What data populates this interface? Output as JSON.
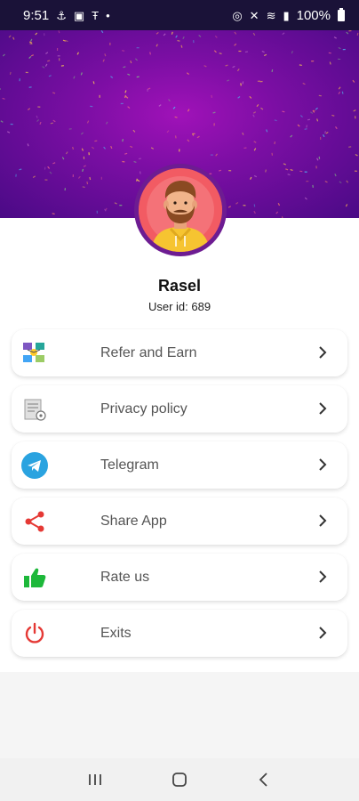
{
  "status_bar": {
    "time": "9:51",
    "battery_text": "100%"
  },
  "profile": {
    "name": "Rasel",
    "user_id_text": "User id: 689"
  },
  "menu": {
    "items": [
      {
        "label": "Refer and Earn",
        "icon": "refer-earn-icon"
      },
      {
        "label": "Privacy policy",
        "icon": "document-icon"
      },
      {
        "label": "Telegram",
        "icon": "telegram-icon"
      },
      {
        "label": "Share App",
        "icon": "share-icon"
      },
      {
        "label": "Rate us",
        "icon": "thumbs-up-icon"
      },
      {
        "label": "Exits",
        "icon": "power-icon"
      }
    ]
  },
  "colors": {
    "header_purple": "#7a0ea3",
    "telegram_blue": "#2aa3e0",
    "share_red": "#e53935",
    "rate_green": "#1db83a",
    "exit_red": "#e53935"
  }
}
